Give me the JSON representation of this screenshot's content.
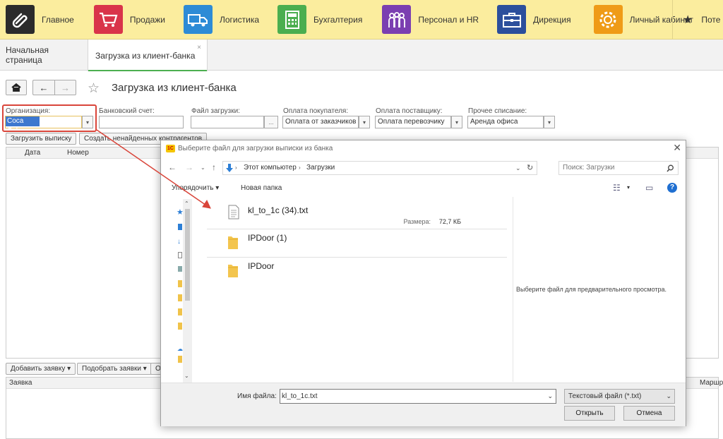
{
  "sections": [
    {
      "name": "main",
      "label": "Главное",
      "color": "#2b2b2b",
      "glyph": "⎋"
    },
    {
      "name": "sales",
      "label": "Продажи",
      "color": "#d9344a",
      "glyph": "🛒"
    },
    {
      "name": "logistics",
      "label": "Логистика",
      "color": "#2d8bd6",
      "glyph": "⛟"
    },
    {
      "name": "accounting",
      "label": "Бухгалтерия",
      "color": "#4bae4f",
      "glyph": "▦"
    },
    {
      "name": "hr",
      "label": "Персонал и HR",
      "color": "#7b3fb1",
      "glyph": "☺"
    },
    {
      "name": "management",
      "label": "Дирекция",
      "color": "#2c4f9c",
      "glyph": "▣"
    },
    {
      "name": "cabinet",
      "label": "Личный кабинет",
      "color": "#ef9b17",
      "glyph": "⚙"
    }
  ],
  "favorites_label": "Поте",
  "tabs": {
    "home": "Начальная страница",
    "active": "Загрузка из клиент-банка",
    "close": "×"
  },
  "page": {
    "title": "Загрузка из клиент-банка"
  },
  "form": {
    "org_label": "Организация:",
    "org_value": "Coca Cola",
    "account_label": "Банковский счет:",
    "account_value": "",
    "file_label": "Файл загрузки:",
    "file_value": "",
    "file_btn": "...",
    "buyer_label": "Оплата покупателя:",
    "buyer_value": "Оплата от заказчиков",
    "supplier_label": "Оплата поставщику:",
    "supplier_value": "Оплата перевозчику",
    "other_label": "Прочее списание:",
    "other_value": "Аренда офиса"
  },
  "buttons": {
    "load": "Загрузить выписку",
    "create": "Создать ненайденных контрагентов",
    "add_request": "Добавить заявку ▾",
    "pick_requests": "Подобрать заявки ▾",
    "more": "О"
  },
  "table1": {
    "col_date": "Дата",
    "col_number": "Номер"
  },
  "table2": {
    "col_request": "Заявка",
    "col_route": "Маршру"
  },
  "dialog": {
    "title": "Выберите файл для загрузки выписки из банка",
    "logo": "1С",
    "close": "✕",
    "path_computer": "Этот компьютер",
    "path_sep": "›",
    "path_folder": "Загрузки",
    "search_placeholder": "Поиск: Загрузки",
    "organize": "Упорядочить ▾",
    "new_folder": "Новая папка",
    "files": [
      {
        "name": "kl_to_1c (34).txt",
        "type": "file",
        "size_label": "Размера:",
        "size": "72,7 КБ"
      },
      {
        "name": "IPDoor (1)",
        "type": "folder"
      },
      {
        "name": "IPDoor",
        "type": "folder"
      }
    ],
    "preview_text": "Выберите файл для предварительного просмотра.",
    "filename_label": "Имя файла:",
    "filename_value": "kl_to_1c.txt",
    "filetype_value": "Текстовый файл (*.txt)",
    "open": "Открыть",
    "cancel": "Отмена"
  },
  "accent_red": "#d9453a"
}
